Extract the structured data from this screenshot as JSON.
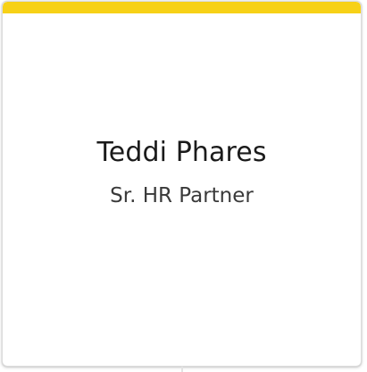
{
  "card": {
    "accent_color": "#f7d117",
    "name": "Teddi Phares",
    "title": "Sr. HR Partner"
  }
}
